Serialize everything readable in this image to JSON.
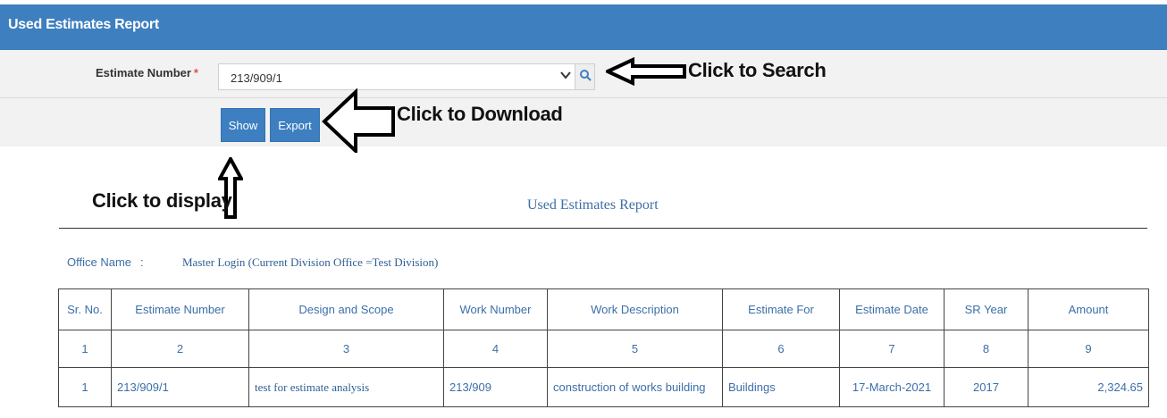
{
  "header": {
    "title": "Used Estimates Report"
  },
  "form": {
    "estimate_label": "Estimate Number",
    "required_mark": "*",
    "estimate_value": "213/909/1",
    "show_label": "Show",
    "export_label": "Export"
  },
  "annotations": {
    "search": "Click to Search",
    "download": "Click to Download",
    "display": "Click to display"
  },
  "report": {
    "title": "Used Estimates Report",
    "office_label": "Office Name",
    "office_sep": ":",
    "office_value": "Master Login (Current Division Office =Test Division)",
    "columns": [
      "Sr. No.",
      "Estimate Number",
      "Design and Scope",
      "Work Number",
      "Work Description",
      "Estimate For",
      "Estimate Date",
      "SR Year",
      "Amount"
    ],
    "column_index": [
      "1",
      "2",
      "3",
      "4",
      "5",
      "6",
      "7",
      "8",
      "9"
    ],
    "rows": [
      {
        "sr_no": "1",
        "estimate_number": "213/909/1",
        "design_scope": "test for estimate analysis",
        "work_number": "213/909",
        "work_description": "construction of works building",
        "estimate_for": "Buildings",
        "estimate_date": "17-March-2021",
        "sr_year": "2017",
        "amount": "2,324.65"
      }
    ]
  },
  "colors": {
    "header_bg": "#3e7fbf",
    "button_bg": "#3d7fc1",
    "report_text": "#3c6fa8",
    "required": "#d9534f"
  },
  "icons": [
    "search-icon",
    "chevron-down-icon",
    "arrow-left-icon",
    "arrow-up-icon"
  ]
}
